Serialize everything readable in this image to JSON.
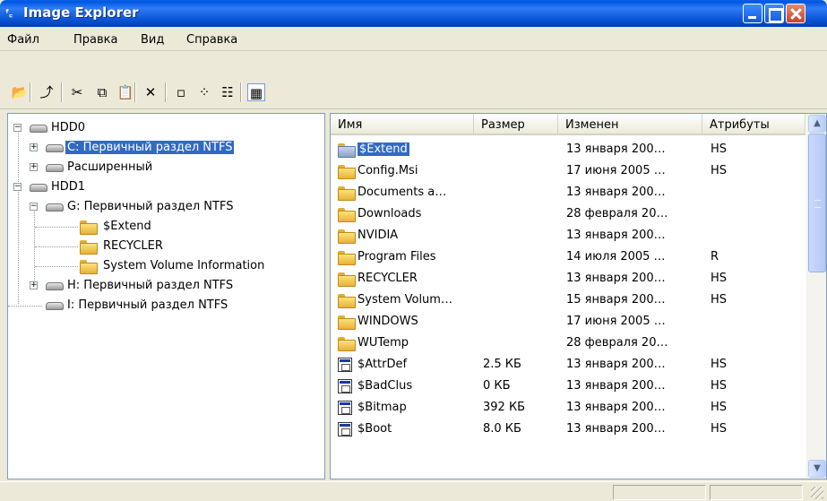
{
  "window": {
    "title": "Image Explorer",
    "app_icon": "image-explorer-app-icon"
  },
  "menu": [
    "Файл",
    "Правка",
    "Вид",
    "Справка"
  ],
  "toolbar": {
    "buttons": [
      {
        "name": "open-icon",
        "glyph": "📂"
      },
      {
        "name": "up-folder-icon",
        "glyph": "⤴"
      },
      {
        "name": "cut-icon",
        "glyph": "✂"
      },
      {
        "name": "copy-icon",
        "glyph": "⧉"
      },
      {
        "name": "paste-icon",
        "glyph": "📋"
      },
      {
        "name": "delete-icon",
        "glyph": "✕"
      },
      {
        "name": "large-icons-view-icon",
        "glyph": "▫"
      },
      {
        "name": "small-icons-view-icon",
        "glyph": "⁘"
      },
      {
        "name": "list-view-icon",
        "glyph": "☷"
      },
      {
        "name": "details-view-icon",
        "glyph": "▦"
      }
    ],
    "active_view": "details-view-icon"
  },
  "tree": [
    {
      "label": "HDD0",
      "type": "disk",
      "expander": "−"
    },
    {
      "label": "C: Первичный раздел NTFS",
      "type": "disk",
      "expander": "+",
      "selected": true
    },
    {
      "label": "Расширенный",
      "type": "disk",
      "expander": "+"
    },
    {
      "label": "HDD1",
      "type": "disk",
      "expander": "−"
    },
    {
      "label": "G: Первичный раздел NTFS",
      "type": "disk",
      "expander": "−"
    },
    {
      "label": "$Extend",
      "type": "folder"
    },
    {
      "label": "RECYCLER",
      "type": "folder"
    },
    {
      "label": "System Volume Information",
      "type": "folder"
    },
    {
      "label": "H: Первичный раздел NTFS",
      "type": "disk",
      "expander": "+"
    },
    {
      "label": "I: Первичный раздел NTFS",
      "type": "disk"
    }
  ],
  "list": {
    "columns": [
      "Имя",
      "Размер",
      "Изменен",
      "Атрибуты"
    ],
    "rows": [
      {
        "name": "$Extend",
        "size": "",
        "modified": "13 января 200…",
        "attrs": "HS",
        "icon": "folder-sys",
        "selected": true
      },
      {
        "name": "Config.Msi",
        "size": "",
        "modified": "17 июня 2005 …",
        "attrs": "HS",
        "icon": "folder"
      },
      {
        "name": "Documents a…",
        "size": "",
        "modified": "13 января 200…",
        "attrs": "",
        "icon": "folder"
      },
      {
        "name": "Downloads",
        "size": "",
        "modified": "28 февраля 20…",
        "attrs": "",
        "icon": "folder"
      },
      {
        "name": "NVIDIA",
        "size": "",
        "modified": "13 января 200…",
        "attrs": "",
        "icon": "folder"
      },
      {
        "name": "Program Files",
        "size": "",
        "modified": "14 июля 2005 …",
        "attrs": "R",
        "icon": "folder"
      },
      {
        "name": "RECYCLER",
        "size": "",
        "modified": "13 января 200…",
        "attrs": "HS",
        "icon": "folder"
      },
      {
        "name": "System Volum…",
        "size": "",
        "modified": "15 января 200…",
        "attrs": "HS",
        "icon": "folder"
      },
      {
        "name": "WINDOWS",
        "size": "",
        "modified": "17 июня 2005 …",
        "attrs": "",
        "icon": "folder"
      },
      {
        "name": "WUTemp",
        "size": "",
        "modified": "28 февраля 20…",
        "attrs": "",
        "icon": "folder"
      },
      {
        "name": "$AttrDef",
        "size": "2.5 КБ",
        "modified": "13 января 200…",
        "attrs": "HS",
        "icon": "file"
      },
      {
        "name": "$BadClus",
        "size": "0 КБ",
        "modified": "13 января 200…",
        "attrs": "HS",
        "icon": "file"
      },
      {
        "name": "$Bitmap",
        "size": "392 КБ",
        "modified": "13 января 200…",
        "attrs": "HS",
        "icon": "file"
      },
      {
        "name": "$Boot",
        "size": "8.0 КБ",
        "modified": "13 января 200…",
        "attrs": "HS",
        "icon": "file"
      }
    ]
  },
  "colors": {
    "selection": "#316ac5",
    "titlebar": "#0a5ee6",
    "chrome": "#ece9d8"
  }
}
